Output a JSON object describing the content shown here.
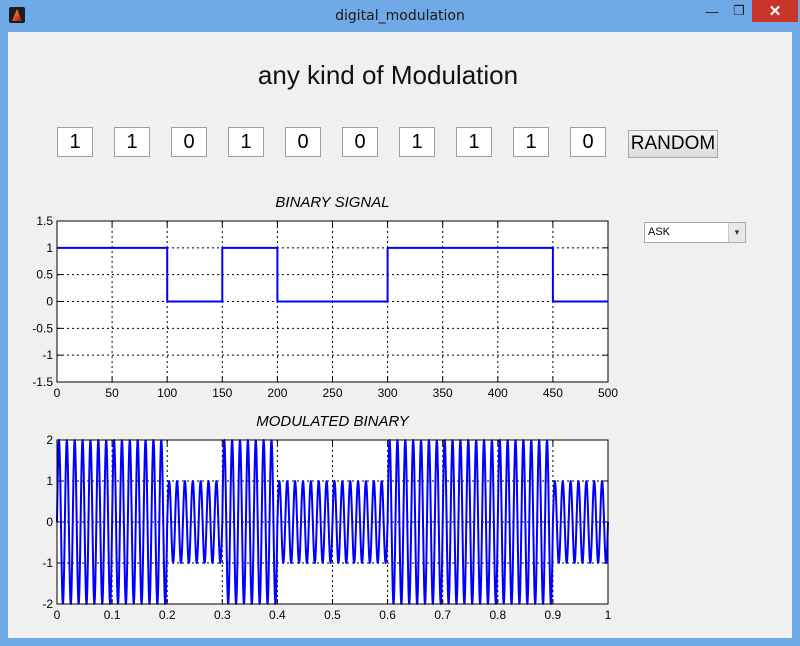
{
  "window": {
    "title": "digital_modulation",
    "minimize_glyph": "—",
    "maximize_glyph": "❐",
    "close_glyph": "✕",
    "icon": "matlab-icon"
  },
  "main": {
    "heading": "any kind of Modulation",
    "bits": [
      "1",
      "1",
      "0",
      "1",
      "0",
      "0",
      "1",
      "1",
      "1",
      "0"
    ],
    "random_label": "RANDOM",
    "modulation_select": {
      "value": "ASK",
      "arrow_glyph": "▾"
    }
  },
  "chart_data": [
    {
      "type": "line",
      "title": "BINARY SIGNAL",
      "xlim": [
        0,
        500
      ],
      "ylim": [
        -1.5,
        1.5
      ],
      "xticks": [
        "0",
        "50",
        "100",
        "150",
        "200",
        "250",
        "300",
        "350",
        "400",
        "450",
        "500"
      ],
      "yticks": [
        "1.5",
        "1",
        "0.5",
        "0",
        "-0.5",
        "-1",
        "-1.5"
      ],
      "grid": true,
      "series": [
        {
          "color": "#0000ff",
          "x": [
            0,
            100,
            100,
            150,
            150,
            200,
            200,
            300,
            300,
            450,
            450,
            500
          ],
          "y": [
            1,
            1,
            0,
            0,
            1,
            1,
            0,
            0,
            1,
            1,
            0,
            0
          ]
        }
      ]
    },
    {
      "type": "line",
      "title": "MODULATED BINARY",
      "xlim": [
        0,
        1
      ],
      "ylim": [
        -2,
        2
      ],
      "xticks": [
        "0",
        "0.1",
        "0.2",
        "0.3",
        "0.4",
        "0.5",
        "0.6",
        "0.7",
        "0.8",
        "0.9",
        "1"
      ],
      "yticks": [
        "2",
        "1",
        "0",
        "-1",
        "-2"
      ],
      "grid": true,
      "carrier_cycles_per_bit": 7,
      "amplitudes_per_bit": [
        2,
        2,
        1,
        2,
        1,
        1,
        2,
        2,
        2,
        1
      ],
      "series": [
        {
          "color": "#0000ff",
          "x": [
            0,
            1
          ],
          "y": [
            0,
            0
          ]
        }
      ]
    }
  ]
}
